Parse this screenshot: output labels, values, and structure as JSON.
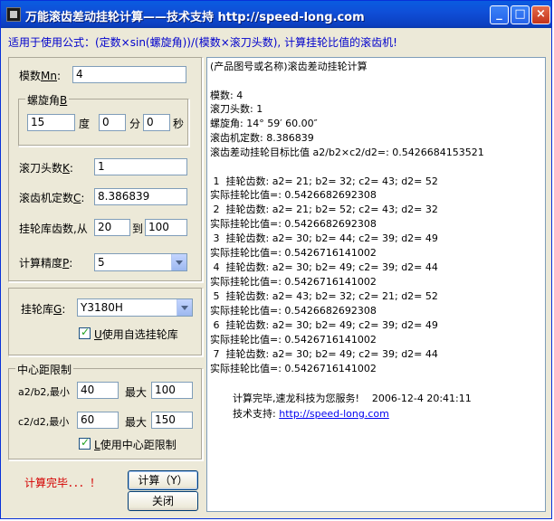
{
  "window": {
    "title": "万能滚齿差动挂轮计算——技术支持 http://speed-long.com",
    "minimize": "_",
    "maximize": "□",
    "close": "×"
  },
  "formula": "适用于使用公式：(定数×sin(螺旋角))/(模数×滚刀头数), 计算挂轮比值的滚齿机!",
  "left": {
    "module_label": "模数",
    "module_key": "Mn",
    "module_value": "4",
    "helix_group": "螺旋角",
    "helix_key": "B",
    "deg_value": "15",
    "deg_label": "度",
    "min_value": "0",
    "min_label": "分",
    "sec_value": "0",
    "sec_label": "秒",
    "hob_label": "滚刀头数",
    "hob_key": "K",
    "hob_value": "1",
    "const_label": "滚齿机定数",
    "const_key": "C",
    "const_value": "8.386839",
    "lib_teeth_label": "挂轮库齿数,从",
    "lib_from": "20",
    "lib_to_label": "到",
    "lib_to": "100",
    "precision_label": "计算精度",
    "precision_key": "P",
    "precision_value": "5",
    "library_label": "挂轮库",
    "library_key": "G",
    "library_value": "Y3180H",
    "custom_lib_key": "U",
    "custom_lib_label": "使用自选挂轮库",
    "center_group": "中心距限制",
    "a2b2_label": "a2/b2,最小",
    "a2b2_min": "40",
    "a2b2_max_label": "最大",
    "a2b2_max": "100",
    "c2d2_label": "c2/d2,最小",
    "c2d2_min": "60",
    "c2d2_max_label": "最大",
    "c2d2_max": "150",
    "center_key": "L",
    "center_check_label": "使用中心距限制",
    "status": "计算完毕．．．！",
    "calc_button": "计算（Y）",
    "close_button": "关闭"
  },
  "output": {
    "lines": [
      "(产品图号或名称)滚齿差动挂轮计算",
      "",
      "模数: 4",
      "滚刀头数: 1",
      "螺旋角: 14° 59′ 60.00″",
      "滚齿机定数: 8.386839",
      "滚齿差动挂轮目标比值 a2/b2×c2/d2=: 0.5426684153521",
      "",
      " 1  挂轮齿数: a2= 21; b2= 32; c2= 43; d2= 52",
      "实际挂轮比值=: 0.5426682692308",
      " 2  挂轮齿数: a2= 21; b2= 52; c2= 43; d2= 32",
      "实际挂轮比值=: 0.5426682692308",
      " 3  挂轮齿数: a2= 30; b2= 44; c2= 39; d2= 49",
      "实际挂轮比值=: 0.5426716141002",
      " 4  挂轮齿数: a2= 30; b2= 49; c2= 39; d2= 44",
      "实际挂轮比值=: 0.5426716141002",
      " 5  挂轮齿数: a2= 43; b2= 32; c2= 21; d2= 52",
      "实际挂轮比值=: 0.5426682692308",
      " 6  挂轮齿数: a2= 30; b2= 49; c2= 39; d2= 49",
      "实际挂轮比值=: 0.5426716141002",
      " 7  挂轮齿数: a2= 30; b2= 49; c2= 39; d2= 44",
      "实际挂轮比值=: 0.5426716141002"
    ],
    "footer_done": "计算完毕,速龙科技为您服务!",
    "footer_time": "2006-12-4 20:41:11",
    "footer_support_label": "技术支持:",
    "footer_link": "http://speed-long.com"
  }
}
